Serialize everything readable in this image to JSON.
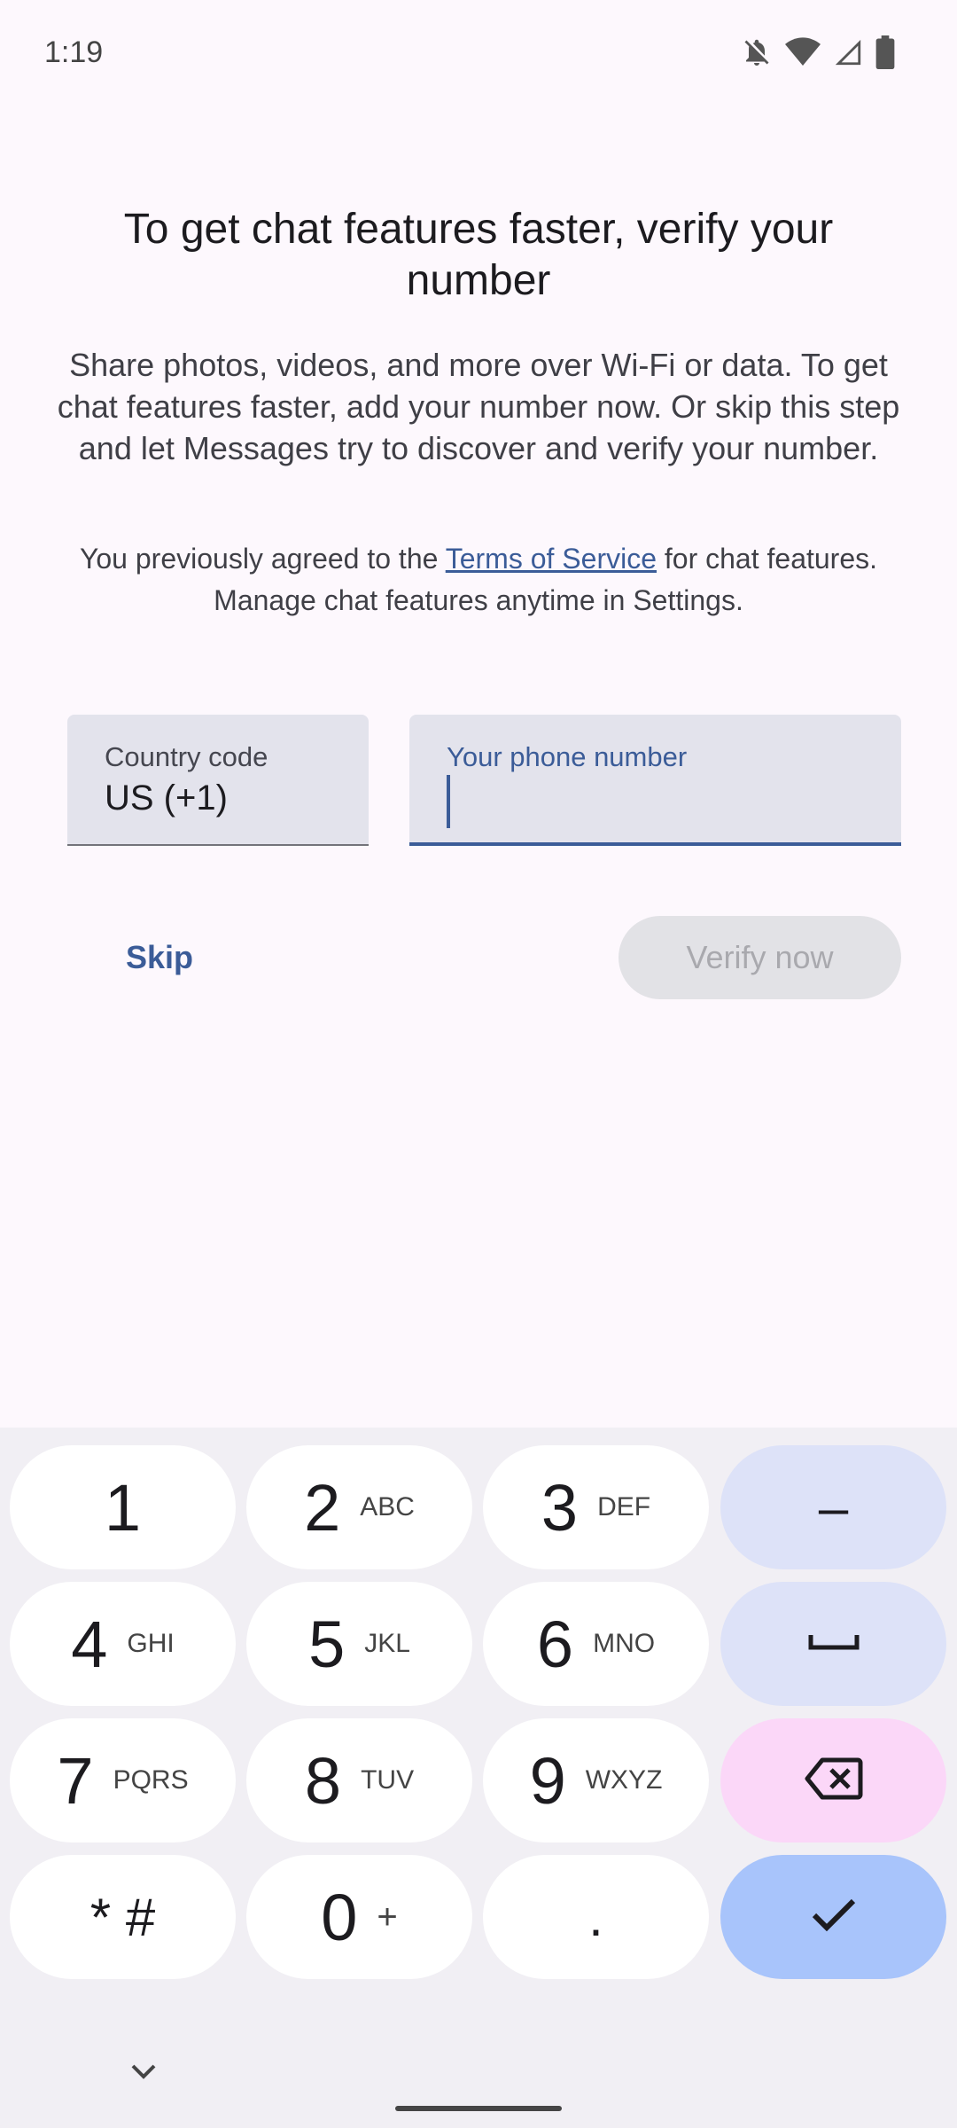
{
  "status_bar": {
    "time": "1:19",
    "icons": [
      "bell-off-icon",
      "wifi-icon",
      "signal-icon",
      "battery-icon"
    ]
  },
  "header": {
    "title": "To get chat features faster, verify your number",
    "body": "Share photos, videos, and more over Wi-Fi or data. To get chat features faster, add your number now. Or skip this step and let Messages try to discover and verify your number.",
    "tos_prefix": "You previously agreed to the ",
    "tos_link": "Terms of Service",
    "tos_suffix": " for chat features. Manage chat features anytime in Settings."
  },
  "form": {
    "country_label": "Country code",
    "country_value": "US (+1)",
    "phone_label": "Your phone number",
    "phone_value": ""
  },
  "actions": {
    "skip": "Skip",
    "verify": "Verify now"
  },
  "keypad": {
    "k1": {
      "num": "1",
      "letters": ""
    },
    "k2": {
      "num": "2",
      "letters": "ABC"
    },
    "k3": {
      "num": "3",
      "letters": "DEF"
    },
    "k4": {
      "num": "4",
      "letters": "GHI"
    },
    "k5": {
      "num": "5",
      "letters": "JKL"
    },
    "k6": {
      "num": "6",
      "letters": "MNO"
    },
    "k7": {
      "num": "7",
      "letters": "PQRS"
    },
    "k8": {
      "num": "8",
      "letters": "TUV"
    },
    "k9": {
      "num": "9",
      "letters": "WXYZ"
    },
    "kstar": {
      "num": "* #"
    },
    "k0": {
      "num": "0",
      "letters": "+"
    },
    "kdot": {
      "num": "."
    },
    "dash": "–"
  },
  "colors": {
    "accent": "#3b5c98",
    "action_key": "#dde2f8",
    "delete_key": "#fbd7f8",
    "done_key": "#a8c4fb"
  }
}
